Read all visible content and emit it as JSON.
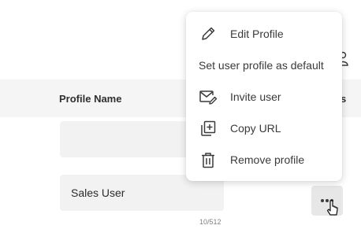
{
  "table": {
    "column_header": "Profile Name",
    "column_header_right": "s",
    "rows": [
      {
        "name_value": ""
      },
      {
        "name_value": "Sales User",
        "char_counter": "10/512"
      }
    ]
  },
  "context_menu": {
    "items": [
      {
        "label": "Edit Profile",
        "icon": "pencil-icon"
      },
      {
        "label": "Set user profile as default",
        "icon": ""
      },
      {
        "label": "Invite user",
        "icon": "envelope-edit-icon"
      },
      {
        "label": "Copy URL",
        "icon": "copy-icon"
      },
      {
        "label": "Remove profile",
        "icon": "trash-icon"
      }
    ]
  },
  "actions": {
    "more_icon": "ellipsis-icon"
  },
  "colors": {
    "header_band": "#f5f5f5",
    "input_bg": "#f2f2f2",
    "more_button_bg": "#e7e7e7",
    "text": "#2b2b2b"
  }
}
